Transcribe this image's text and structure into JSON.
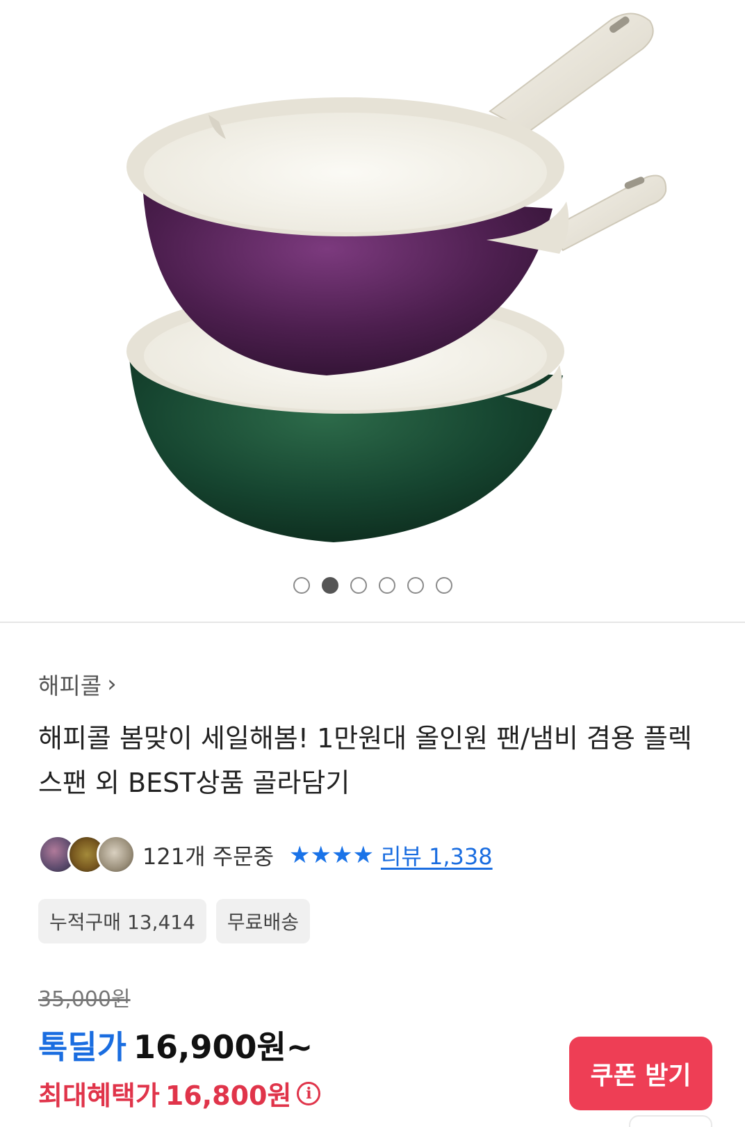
{
  "gallery": {
    "image_alt": "purple and green ceramic pans",
    "slide_count": 6,
    "active_slide": 2
  },
  "product": {
    "brand": "해피콜",
    "brand_chevron": "›",
    "title": "해피콜 봄맞이 세일해봄! 1만원대 올인원 팬/냄비 겸용 플렉스팬 외 BEST상품 골라담기"
  },
  "stats": {
    "orders_text": "121개 주문중",
    "rating_stars": 4,
    "review_text": "리뷰 1,338"
  },
  "tags": [
    "누적구매 13,414",
    "무료배송"
  ],
  "pricing": {
    "original_price": "35,000원",
    "deal_label": "톡딜가",
    "deal_price": "16,900원~",
    "max_label": "최대혜택가",
    "max_price": "16,800원",
    "info_icon": "ⓘ"
  },
  "actions": {
    "coupon_label": "쿠폰 받기"
  },
  "colors": {
    "accent_blue": "#1a6de0",
    "accent_red": "#e0344a",
    "coupon_bg": "#ee3e55"
  }
}
